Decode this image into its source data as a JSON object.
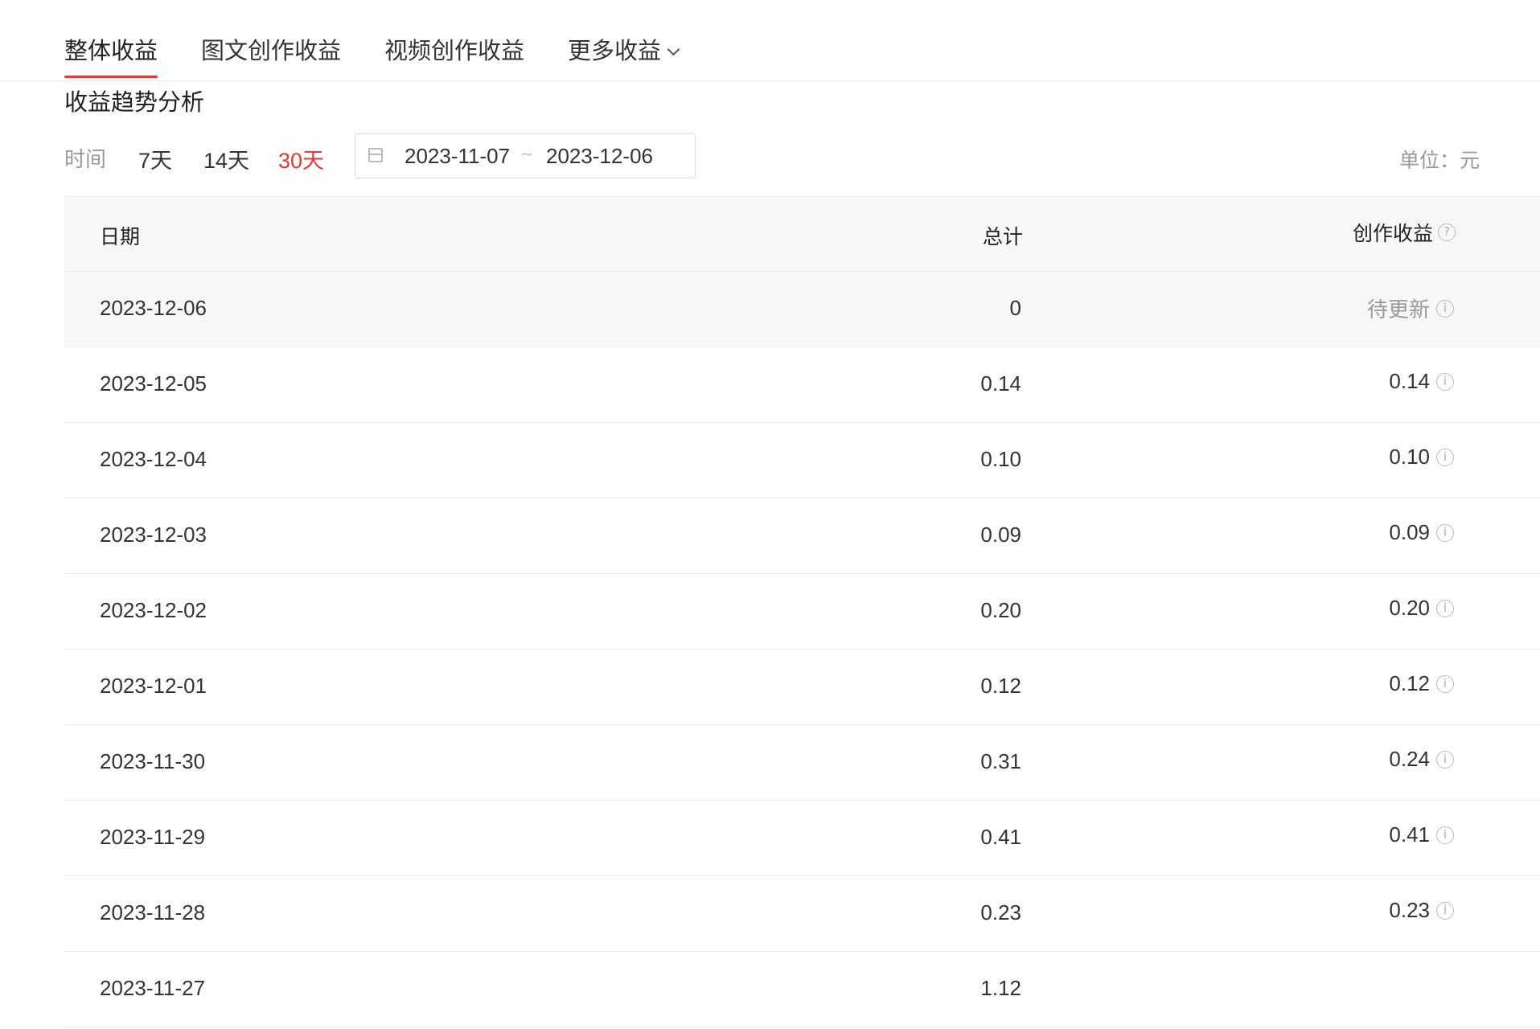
{
  "tabs": [
    {
      "label": "整体收益",
      "active": true
    },
    {
      "label": "图文创作收益",
      "active": false
    },
    {
      "label": "视频创作收益",
      "active": false
    },
    {
      "label": "更多收益",
      "active": false
    }
  ],
  "section_title": "收益趋势分析",
  "filter": {
    "time_label": "时间",
    "periods": [
      {
        "label": "7天",
        "active": false
      },
      {
        "label": "14天",
        "active": false
      },
      {
        "label": "30天",
        "active": true
      }
    ],
    "date_start": "2023-11-07",
    "date_separator": "~",
    "date_end": "2023-12-06",
    "unit_label": "单位：元"
  },
  "table": {
    "headers": {
      "date": "日期",
      "total": "总计",
      "creation": "创作收益"
    },
    "rows": [
      {
        "date": "2023-12-06",
        "total": "0",
        "creation": "待更新"
      },
      {
        "date": "2023-12-05",
        "total": "0.14",
        "creation": "0.14"
      },
      {
        "date": "2023-12-04",
        "total": "0.10",
        "creation": "0.10"
      },
      {
        "date": "2023-12-03",
        "total": "0.09",
        "creation": "0.09"
      },
      {
        "date": "2023-12-02",
        "total": "0.20",
        "creation": "0.20"
      },
      {
        "date": "2023-12-01",
        "total": "0.12",
        "creation": "0.12"
      },
      {
        "date": "2023-11-30",
        "total": "0.31",
        "creation": "0.24"
      },
      {
        "date": "2023-11-29",
        "total": "0.41",
        "creation": "0.41"
      },
      {
        "date": "2023-11-28",
        "total": "0.23",
        "creation": "0.23"
      },
      {
        "date": "2023-11-27",
        "total": "1.12",
        "creation": ""
      }
    ]
  },
  "colors": {
    "accent": "#e03a3a",
    "muted": "#999999"
  },
  "icons": {
    "calendar": "calendar-icon",
    "question": "question-icon",
    "info": "info-icon",
    "chevron": "chevron-down-icon"
  }
}
